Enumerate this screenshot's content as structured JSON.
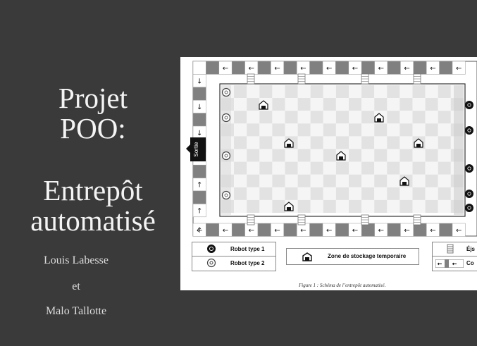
{
  "title": {
    "line1": "Projet",
    "line2": "POO:",
    "line3": "Entrepôt",
    "line4": "automatisé"
  },
  "authors": {
    "first": "Louis Labesse",
    "connector": "et",
    "second": "Malo Tallotte"
  },
  "figure": {
    "caption": "Figure 1 : Schéma de l’entrepôt automatisé.",
    "exit_label": "Sortie",
    "legend": {
      "robot_type_1": "Robot type 1",
      "robot_type_2": "Robot type 2",
      "storage_zone": "Zone de stockage temporaire",
      "ejector_partial": "Éjs",
      "conveyor_partial": "Co"
    },
    "colors": {
      "dark_square": "#808080",
      "checker_light": "#f5f5f5",
      "checker_dark": "#e2e2e2",
      "exit": "#111111"
    },
    "icons": {
      "arrow_left": "←",
      "arrow_up": "↑",
      "arrow_down": "↓"
    }
  }
}
